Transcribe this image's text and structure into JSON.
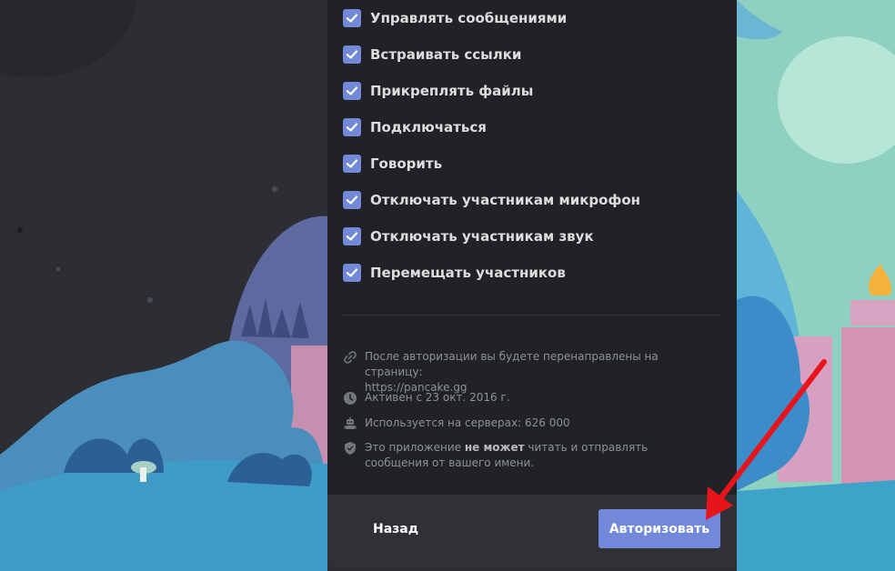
{
  "permissions": [
    {
      "label": "Управлять сообщениями",
      "checked": true
    },
    {
      "label": "Встраивать ссылки",
      "checked": true
    },
    {
      "label": "Прикреплять файлы",
      "checked": true
    },
    {
      "label": "Подключаться",
      "checked": true
    },
    {
      "label": "Говорить",
      "checked": true
    },
    {
      "label": "Отключать участникам микрофон",
      "checked": true
    },
    {
      "label": "Отключать участникам звук",
      "checked": true
    },
    {
      "label": "Перемещать участников",
      "checked": true
    }
  ],
  "info": {
    "redirect_text": "После авторизации вы будете перенаправлены на страницу:",
    "redirect_url": "https://pancake.gg",
    "active_since": "Активен с 23 окт. 2016 г.",
    "servers": "Используется на серверах: 626 000",
    "privacy_prefix": "Это приложение ",
    "privacy_bold": "не может",
    "privacy_suffix": " читать и отправлять сообщения от вашего имени."
  },
  "footer": {
    "back_label": "Назад",
    "authorize_label": "Авторизовать"
  },
  "colors": {
    "accent": "#7289da",
    "modal_bg": "#202225",
    "footer_bg": "#2f3136",
    "arrow": "#e8141c"
  },
  "icons": {
    "checkbox": "check-icon",
    "redirect": "link-icon",
    "active": "clock-icon",
    "servers": "robot-icon",
    "privacy": "shield-icon"
  }
}
